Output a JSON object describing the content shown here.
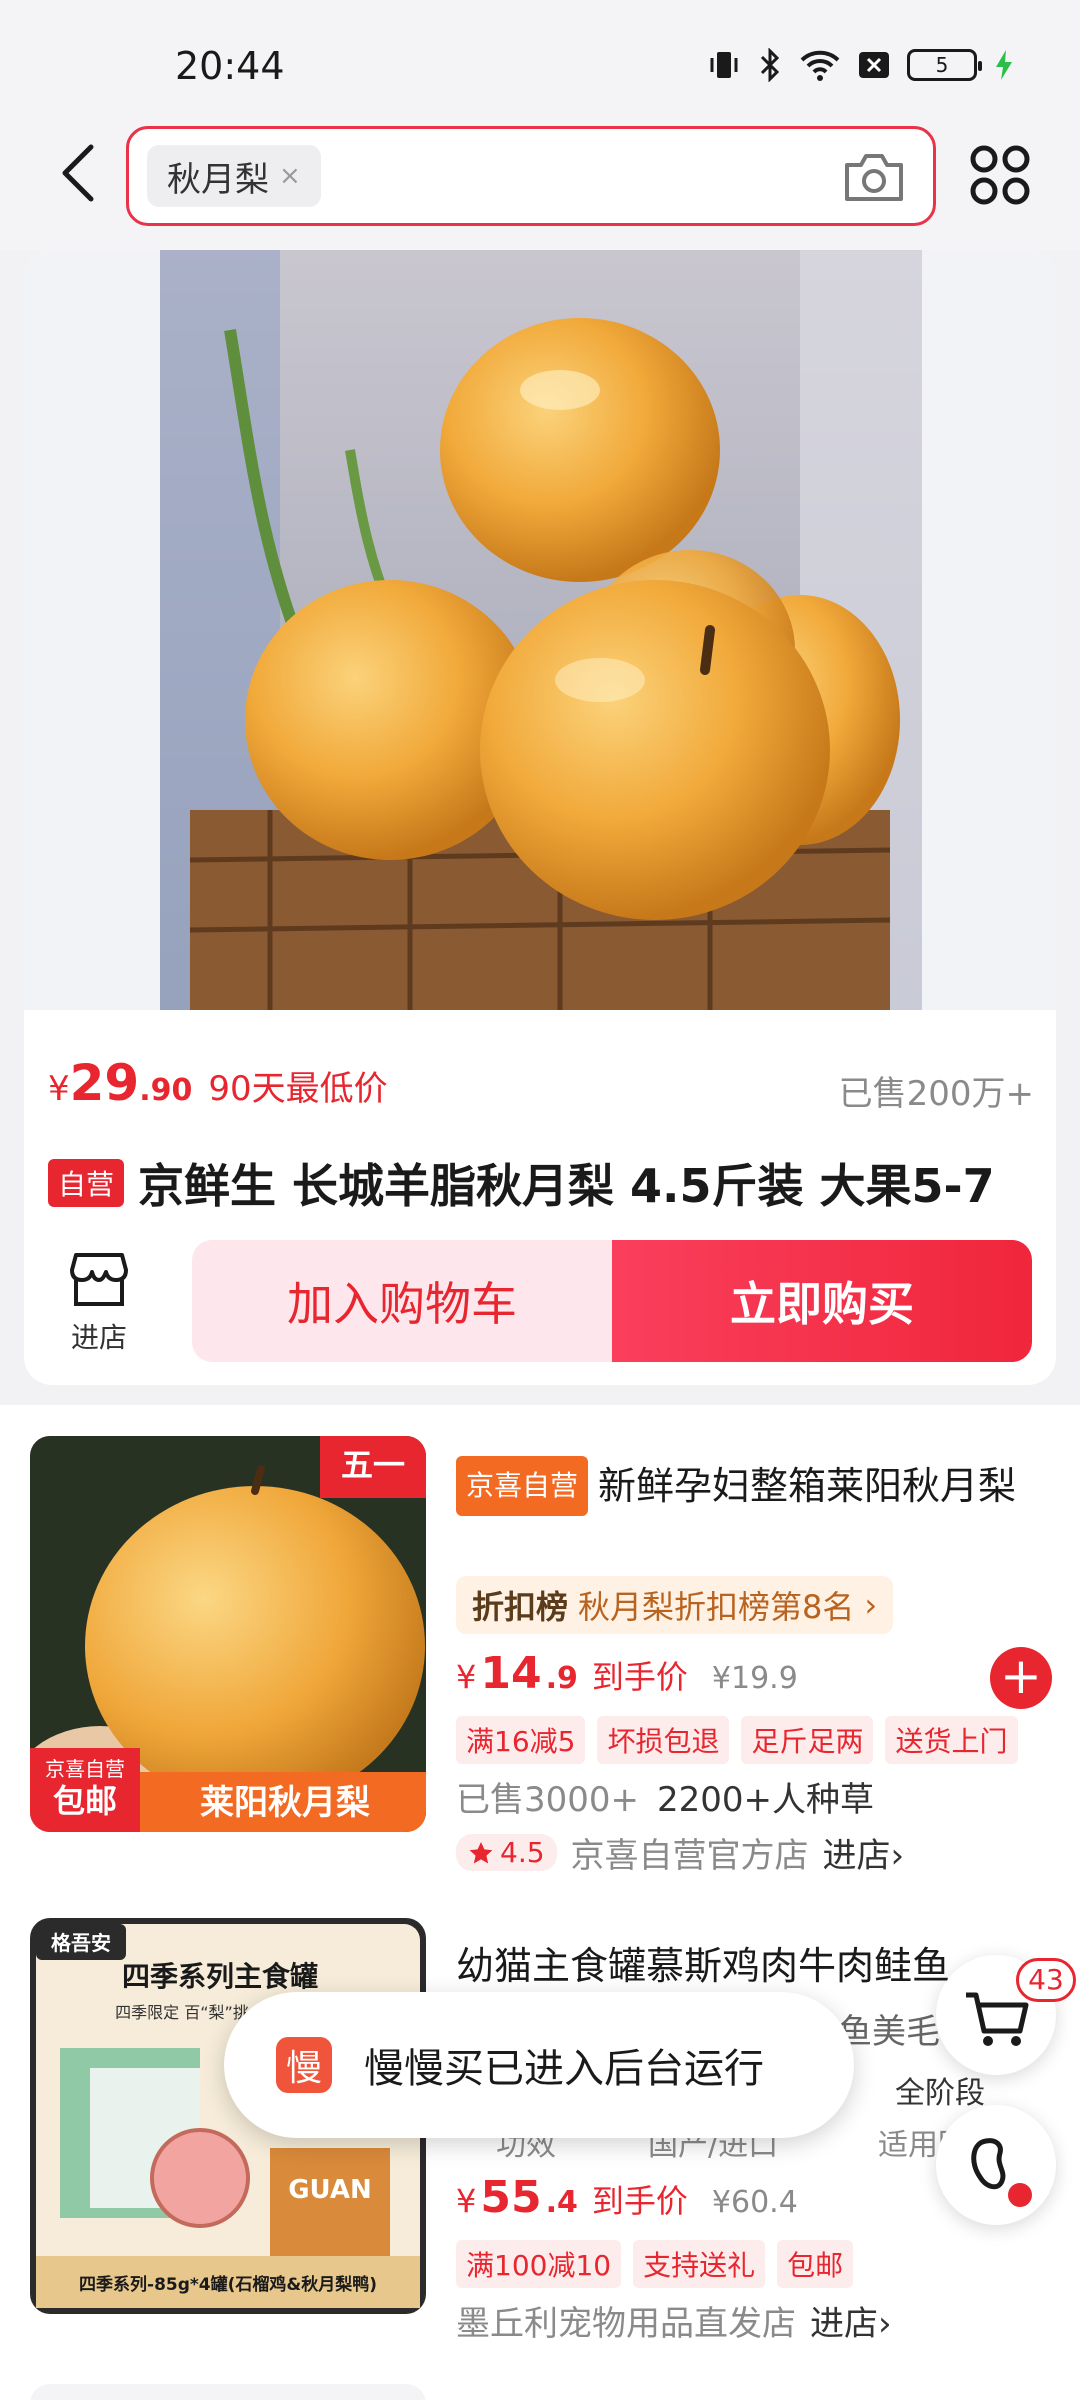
{
  "status_bar": {
    "time": "20:44",
    "battery": "5",
    "icons": [
      "vibrate-icon",
      "bluetooth-icon",
      "wifi-icon",
      "notification-icon",
      "battery-icon",
      "charging-icon"
    ]
  },
  "search": {
    "chip_text": "秋月梨",
    "chip_close": "×"
  },
  "main_product": {
    "currency": "¥",
    "price_int": "29",
    "price_dec": ".90",
    "price_tag": "90天最低价",
    "sold": "已售200万+",
    "self_tag": "自营",
    "title": "京鲜生 长城羊脂秋月梨 4.5斤装 大果5-7",
    "shop_label": "进店",
    "add_to_cart": "加入购物车",
    "buy_now": "立即购买"
  },
  "products": [
    {
      "badge_top": "五一",
      "badge_store": "京喜自营",
      "badge_ship": "包邮",
      "banner": "莱阳秋月梨",
      "store_tag": "京喜自营",
      "title": "新鲜孕妇整箱莱阳秋月梨",
      "rank_logo": "折扣榜",
      "rank_text": "秋月梨折扣榜第8名",
      "rank_arrow": "›",
      "currency": "¥",
      "price_int": "14",
      "price_dec": ".9",
      "price_label": "到手价",
      "orig_price": "¥19.9",
      "promos": [
        "满16减5",
        "坏损包退",
        "足斤足两",
        "送货上门"
      ],
      "sales": "已售3000+",
      "hot": "2200+人种草",
      "rating": "4.5",
      "shop_name": "京喜自营官方店",
      "shop_link": "进店›",
      "add": "+"
    },
    {
      "brand": "格吾安",
      "thumb_title": "四季系列主食罐",
      "thumb_sub": "四季限定 百“梨”挑一",
      "thumb_footer": "四季系列-85g*4罐(石榴鸡&秋月梨鸭)",
      "title": "幼猫主食罐慕斯鸡肉牛肉鲑鱼",
      "title_cont": "鱼美毛",
      "extra_right": "全阶段",
      "spec_left": "功效",
      "spec_mid": "国产/进口",
      "spec_right": "适用阶",
      "currency": "¥",
      "price_int": "55",
      "price_dec": ".4",
      "price_label": "到手价",
      "orig_price": "¥60.4",
      "promos": [
        "满100减10",
        "支持送礼",
        "包邮"
      ],
      "shop_name": "墨丘利宠物用品直发店",
      "shop_link": "进店›"
    }
  ],
  "toast": {
    "icon_text": "慢",
    "text": "慢慢买已进入后台运行"
  },
  "float": {
    "cart_count": "43"
  },
  "colors": {
    "accent": "#e8262f",
    "search_border": "#e8334a",
    "buy_button": "#f0263b",
    "store_tag": "#f36a23"
  }
}
